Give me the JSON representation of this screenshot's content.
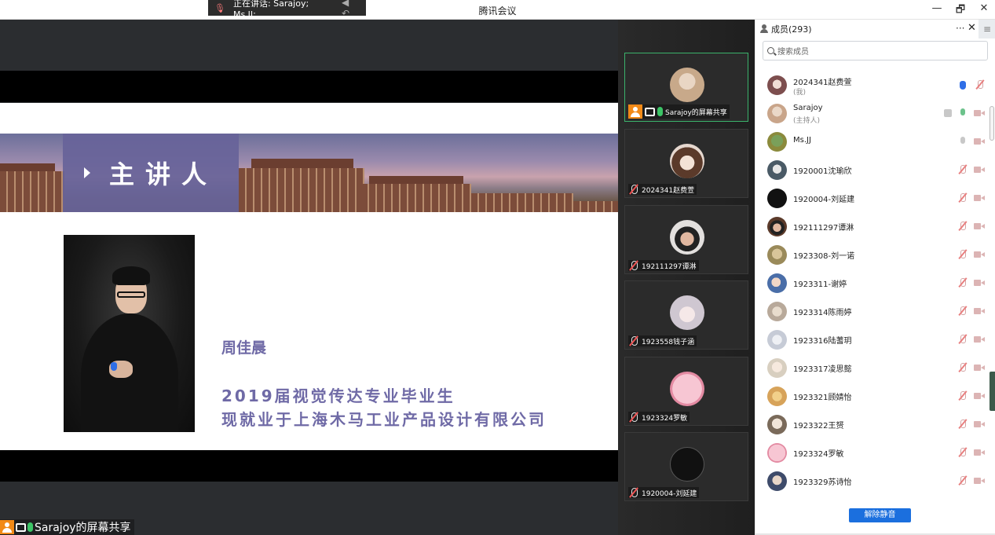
{
  "window": {
    "title": "腾讯会议",
    "speaking_label": "正在讲话: Sarajoy; Ms.JJ;",
    "controls": [
      "—",
      "🗗",
      "✕"
    ]
  },
  "share": {
    "banner_title": "主讲人",
    "speaker_name": "周佳晨",
    "speaker_line1": "2019届视觉传达专业毕业生",
    "speaker_line2": "现就业于上海木马工业产品设计有限公司",
    "share_label": "Sarajoy的屏幕共享"
  },
  "video_tiles": [
    {
      "name": "Sarajoy的屏幕共享",
      "icon": "person-screen-mic",
      "avatar_color": "#c8a98a",
      "active": true
    },
    {
      "name": "2024341赵费萱",
      "icon": "mic-muted",
      "avatar_color": "#e6d8cf",
      "active": false
    },
    {
      "name": "192111297谭淋",
      "icon": "mic-muted",
      "avatar_color": "#e3e0de",
      "active": false
    },
    {
      "name": "1923558钱子涵",
      "icon": "mic-muted",
      "avatar_color": "#cfc7d1",
      "active": false
    },
    {
      "name": "1923324罗敏",
      "icon": "mic-muted",
      "avatar_color": "#f2b5c3",
      "active": false
    },
    {
      "name": "1920004-刘延建",
      "icon": "mic-muted",
      "avatar_color": "#111111",
      "active": false
    }
  ],
  "members_panel": {
    "header": "成员(293)",
    "more_label": "···",
    "close_label": "✕",
    "menu_label": "≡",
    "search_placeholder": "搜索成员",
    "unmute_button": "解除静音",
    "members": [
      {
        "name": "2024341赵费萱",
        "sub": "(我)",
        "mic": "hand",
        "cam": "muted",
        "avatar_color": "#7d4e4e"
      },
      {
        "name": "Sarajoy",
        "sub": "(主持人)",
        "mic": "on",
        "cam": "muted",
        "avatar_color": "#c9a58a"
      },
      {
        "name": "Ms.JJ",
        "sub": "",
        "mic": "off",
        "cam": "muted",
        "avatar_color": "#8b8a3c"
      },
      {
        "name": "1920001沈瑜欣",
        "sub": "",
        "mic": "muted",
        "cam": "muted",
        "avatar_color": "#4a5a66"
      },
      {
        "name": "1920004-刘延建",
        "sub": "",
        "mic": "muted",
        "cam": "muted",
        "avatar_color": "#111111"
      },
      {
        "name": "192111297谭淋",
        "sub": "",
        "mic": "muted",
        "cam": "muted",
        "avatar_color": "#5b3a2a"
      },
      {
        "name": "1923308-刘一诺",
        "sub": "",
        "mic": "muted",
        "cam": "muted",
        "avatar_color": "#9a8a5a"
      },
      {
        "name": "1923311-谢婷",
        "sub": "",
        "mic": "muted",
        "cam": "muted",
        "avatar_color": "#4a6ea8"
      },
      {
        "name": "1923314陈雨婷",
        "sub": "",
        "mic": "muted",
        "cam": "muted",
        "avatar_color": "#b8a99a"
      },
      {
        "name": "1923316陆蓍玥",
        "sub": "",
        "mic": "muted",
        "cam": "muted",
        "avatar_color": "#c6cbd6"
      },
      {
        "name": "1923317凌思懿",
        "sub": "",
        "mic": "muted",
        "cam": "muted",
        "avatar_color": "#d8cfc0"
      },
      {
        "name": "1923321顾婧怡",
        "sub": "",
        "mic": "muted",
        "cam": "muted",
        "avatar_color": "#d7a35a"
      },
      {
        "name": "1923322王赟",
        "sub": "",
        "mic": "muted",
        "cam": "muted",
        "avatar_color": "#7a6a5a"
      },
      {
        "name": "1923324罗敏",
        "sub": "",
        "mic": "muted",
        "cam": "muted",
        "avatar_color": "#f2b5c3"
      },
      {
        "name": "1923329苏诗怡",
        "sub": "",
        "mic": "muted",
        "cam": "muted",
        "avatar_color": "#3e4b6a"
      }
    ]
  }
}
